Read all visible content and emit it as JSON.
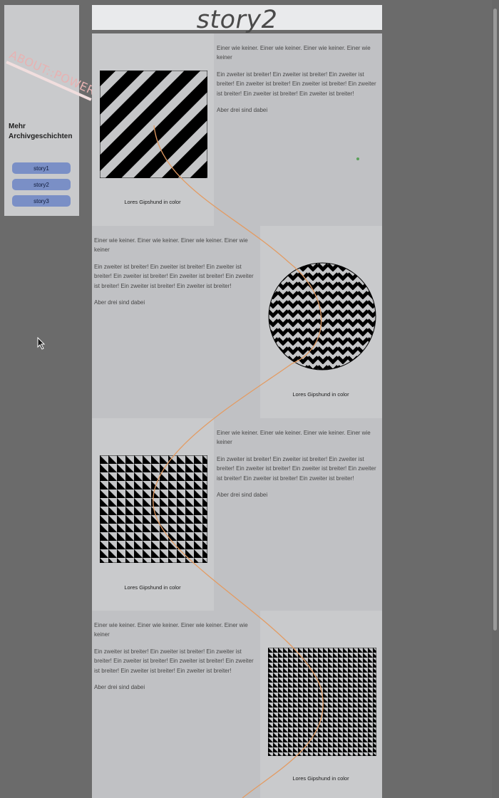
{
  "sidebar": {
    "logo": "ABOUT::POWER",
    "more_title": "Mehr Archivgeschichten",
    "stories": [
      "story1",
      "story2",
      "story3"
    ]
  },
  "header": {
    "title": "story2"
  },
  "sections": [
    {
      "p1": "Einer wie keiner. Einer wie keiner. Einer wie keiner. Einer wie keiner",
      "p2": "Ein zweiter ist breiter! Ein zweiter ist breiter! Ein zweiter ist breiter! Ein zweiter ist breiter! Ein zweiter ist breiter! Ein zweiter ist breiter! Ein zweiter ist breiter! Ein zweiter ist breiter!",
      "p3": "Aber drei sind dabei",
      "caption": "Lores Gipshund in color"
    },
    {
      "p1": "Einer wie keiner. Einer wie keiner. Einer wie keiner. Einer wie keiner",
      "p2": "Ein zweiter ist breiter! Ein zweiter ist breiter! Ein zweiter ist breiter! Ein zweiter ist breiter! Ein zweiter ist breiter! Ein zweiter ist breiter! Ein zweiter ist breiter! Ein zweiter ist breiter!",
      "p3": "Aber drei sind dabei",
      "caption": "Lores Gipshund in color"
    },
    {
      "p1": "Einer wie keiner. Einer wie keiner. Einer wie keiner. Einer wie keiner",
      "p2": "Ein zweiter ist breiter! Ein zweiter ist breiter! Ein zweiter ist breiter! Ein zweiter ist breiter! Ein zweiter ist breiter! Ein zweiter ist breiter! Ein zweiter ist breiter! Ein zweiter ist breiter!",
      "p3": "Aber drei sind dabei",
      "caption": "Lores Gipshund in color"
    },
    {
      "p1": "Einer wie keiner. Einer wie keiner. Einer wie keiner. Einer wie keiner",
      "p2": "Ein zweiter ist breiter! Ein zweiter ist breiter! Ein zweiter ist breiter! Ein zweiter ist breiter! Ein zweiter ist breiter! Ein zweiter ist breiter! Ein zweiter ist breiter! Ein zweiter ist breiter!",
      "p3": "Aber drei sind dabei",
      "caption": "Lores Gipshund in color"
    }
  ],
  "icons": [
    "mouse-cursor-icon"
  ],
  "colors": {
    "background": "#6b6b6b",
    "panel": "#c9cacc",
    "button": "#7a8fc6",
    "curve": "#e39b62"
  }
}
